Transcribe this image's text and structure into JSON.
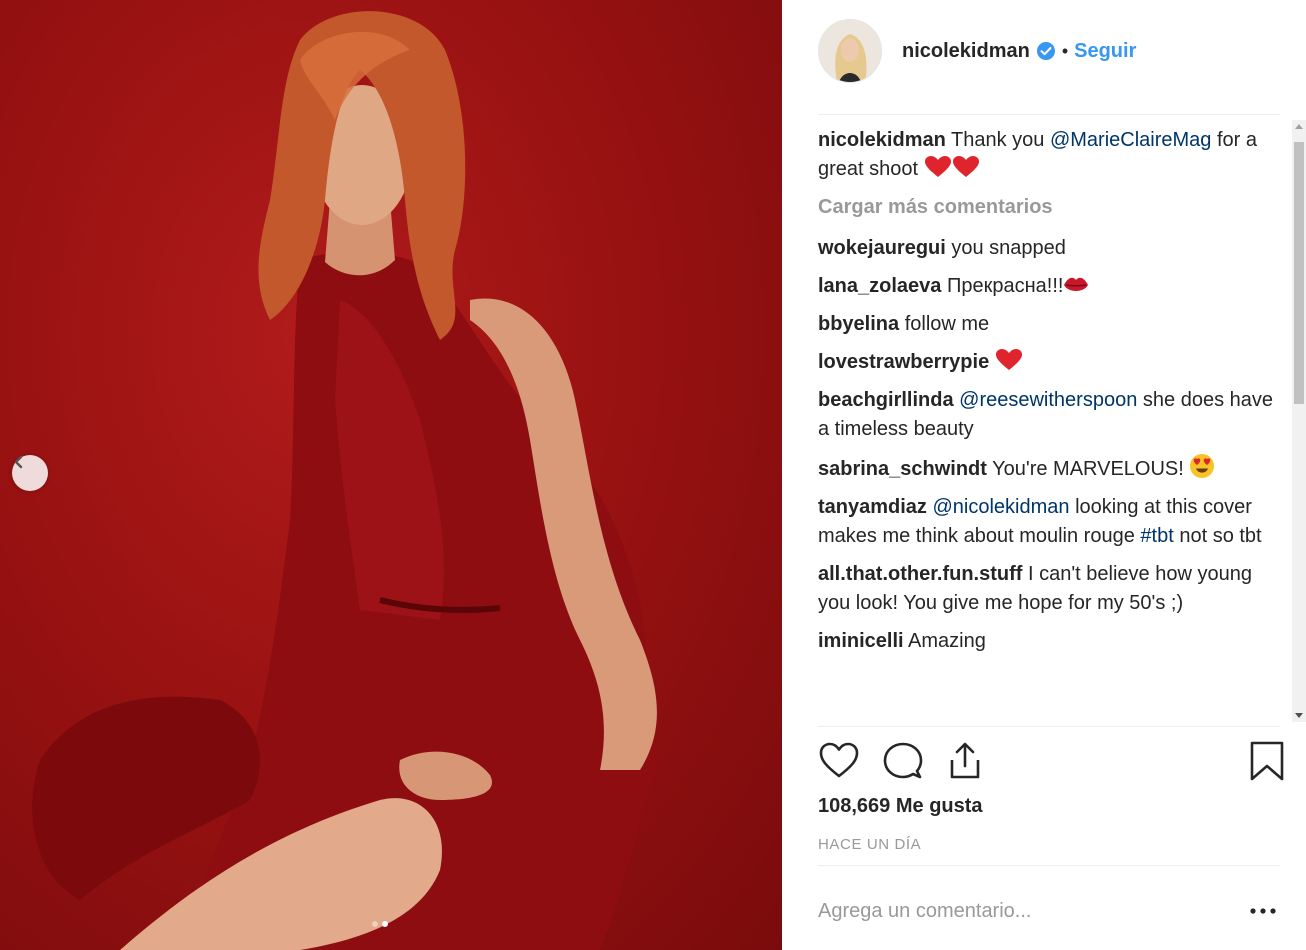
{
  "post": {
    "username": "nicolekidman",
    "follow_label": "Seguir",
    "separator": "•",
    "load_more": "Cargar más comentarios",
    "likes": "108,669 Me gusta",
    "time": "HACE UN DÍA",
    "add_comment_placeholder": "Agrega un comentario...",
    "carousel": {
      "count": 2,
      "active": 2
    }
  },
  "caption": {
    "user": "nicolekidman",
    "pre": "Thank you",
    "mention": "@MarieClaireMag",
    "post": "for a great shoot",
    "emoji": "red-heart-icon"
  },
  "comments": [
    {
      "user": "wokejauregui",
      "text": "you snapped"
    },
    {
      "user": "lana_zolaeva",
      "text": "Прекрасна!!!",
      "emoji": "kiss-lips-icon"
    },
    {
      "user": "bbyelina",
      "text": "follow me"
    },
    {
      "user": "lovestrawberrypie",
      "text": "",
      "emoji": "red-heart-icon"
    },
    {
      "user": "beachgirllinda",
      "mention": "@reesewitherspoon",
      "text": "she does have a timeless beauty"
    },
    {
      "user": "sabrina_schwindt",
      "text": "You're MARVELOUS!",
      "emoji": "heart-eyes-icon"
    },
    {
      "user": "tanyamdiaz",
      "mention": "@nicolekidman",
      "text": "looking at this cover makes me think about moulin rouge",
      "hashtag": "#tbt",
      "text2": "not so tbt"
    },
    {
      "user": "all.that.other.fun.stuff",
      "text": "I can't believe how young you look! You give me hope for my 50's ;)"
    },
    {
      "user": "iminicelli",
      "text": "Amazing"
    }
  ],
  "colors": {
    "accent": "#3897f0",
    "mention": "#003569",
    "muted": "#999999",
    "photo_bg": "#9a1212"
  }
}
